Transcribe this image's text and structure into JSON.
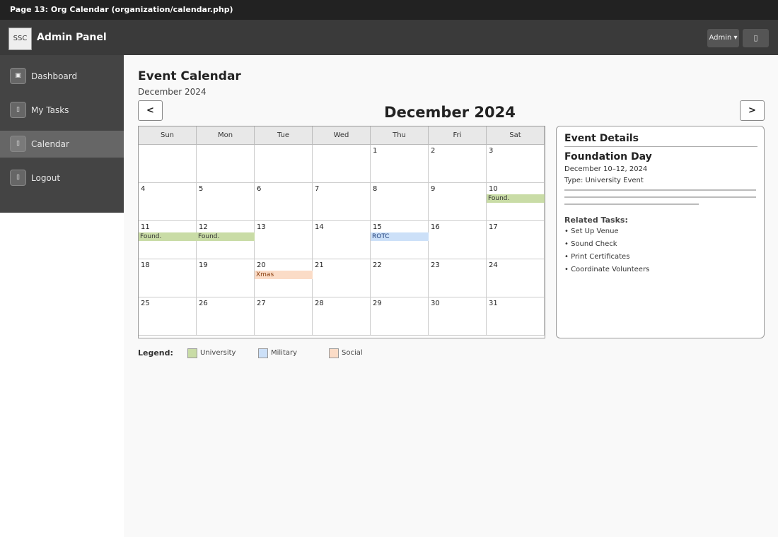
{
  "banner": "Page 13: Org Calendar (organization/calendar.php)",
  "header": {
    "logo": "SSC",
    "title": "Admin Panel",
    "admin_label": "Admin ▾",
    "bell_icon": "bell-icon"
  },
  "sidebar": {
    "items": [
      {
        "label": "Dashboard",
        "icon": "dashboard-icon",
        "glyph": "▣"
      },
      {
        "label": "My Tasks",
        "icon": "tasks-icon",
        "glyph": "▯"
      },
      {
        "label": "Calendar",
        "icon": "calendar-icon",
        "glyph": "▯"
      },
      {
        "label": "Logout",
        "icon": "logout-icon",
        "glyph": "▯"
      }
    ],
    "active_index": 2
  },
  "main": {
    "title": "Event Calendar",
    "subtitle": "December 2024",
    "month_label": "December 2024",
    "prev_label": "<",
    "next_label": ">"
  },
  "calendar": {
    "weekdays": [
      "Sun",
      "Mon",
      "Tue",
      "Wed",
      "Thu",
      "Fri",
      "Sat"
    ],
    "weeks": [
      [
        "",
        "",
        "",
        "",
        "1",
        "2",
        "3"
      ],
      [
        "4",
        "5",
        "6",
        "7",
        "8",
        "9",
        "10"
      ],
      [
        "11",
        "12",
        "13",
        "14",
        "15",
        "16",
        "17"
      ],
      [
        "18",
        "19",
        "20",
        "21",
        "22",
        "23",
        "24"
      ],
      [
        "25",
        "26",
        "27",
        "28",
        "29",
        "30",
        "31"
      ]
    ],
    "events": [
      {
        "week": 1,
        "day": 6,
        "label": "Found.",
        "category": "university"
      },
      {
        "week": 2,
        "day": 0,
        "label": "Found.",
        "category": "university"
      },
      {
        "week": 2,
        "day": 1,
        "label": "Found.",
        "category": "university"
      },
      {
        "week": 2,
        "day": 4,
        "label": "ROTC",
        "category": "military"
      },
      {
        "week": 3,
        "day": 2,
        "label": "Xmas",
        "category": "social"
      }
    ]
  },
  "details": {
    "title": "Event Details",
    "event_name": "Foundation Day",
    "dates": "December 10–12, 2024",
    "type": "Type: University Event",
    "related_title": "Related Tasks:",
    "tasks": [
      "• Set Up Venue",
      "• Sound Check",
      "• Print Certificates",
      "• Coordinate Volunteers"
    ]
  },
  "legend": {
    "title": "Legend:",
    "items": [
      {
        "label": "University",
        "color": "#c9dca6"
      },
      {
        "label": "Military",
        "color": "#cce0f8"
      },
      {
        "label": "Social",
        "color": "#fbdcc7"
      }
    ]
  }
}
